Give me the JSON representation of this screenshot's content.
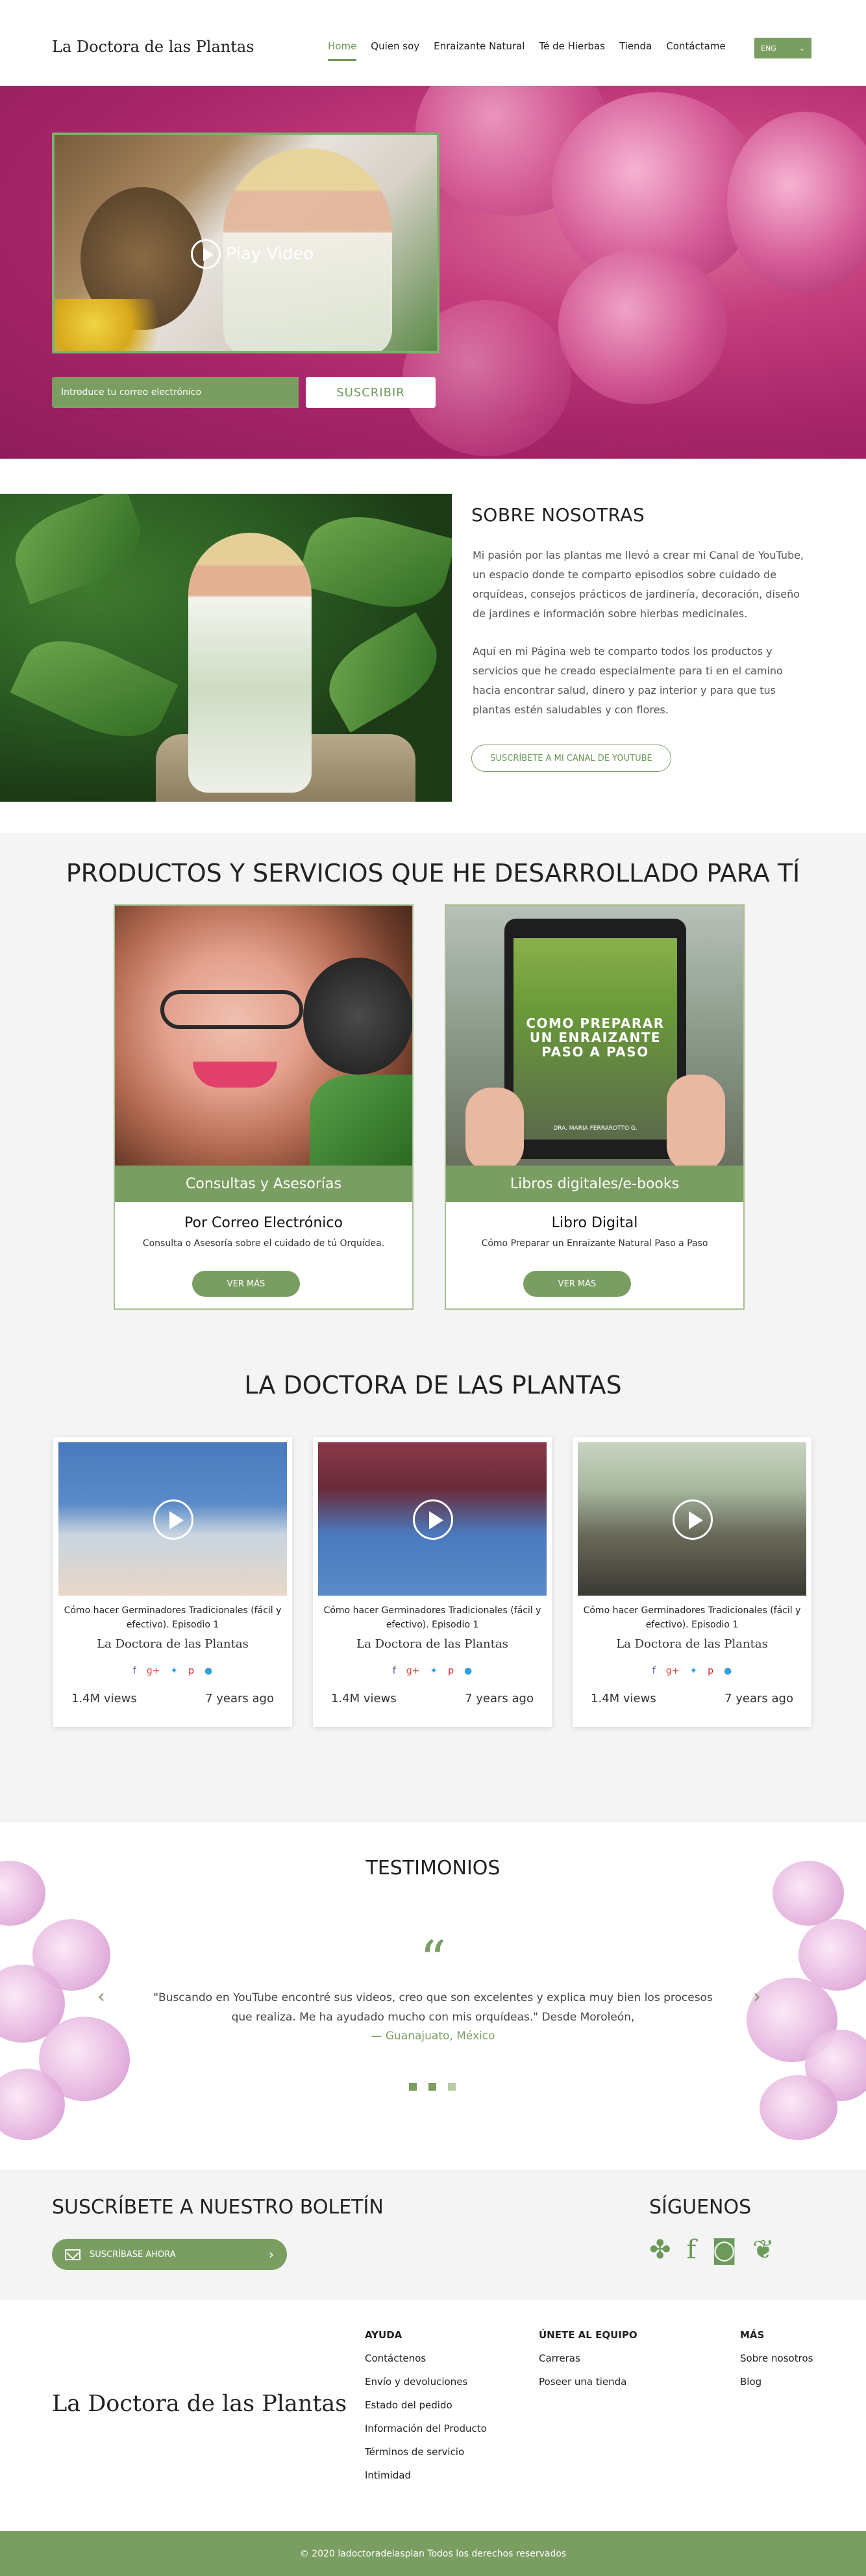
{
  "header": {
    "brand": "La Doctora de las Plantas",
    "nav": [
      "Home",
      "Quien soy",
      "Enraizante Natural",
      "Té de Hierbas",
      "Tienda",
      "Contáctame"
    ],
    "lang": "ENG"
  },
  "hero": {
    "video_label": "Play Video",
    "email_placeholder": "Introduce tu correo electrónico",
    "subscribe": "SUSCRIBIR"
  },
  "about": {
    "title": "SOBRE NOSOTRAS",
    "p1": "Mi pasión por las plantas me llevó a crear mi Canal de YouTube, un espacio donde te comparto episodios sobre cuidado de orquídeas,  consejos prácticos de jardinería, decoración, diseño de jardines e información sobre hierbas medicinales.",
    "p2": "Aquí en mi Página web te comparto todos los productos y servicios que he creado especialmente para ti en el camino hacia encontrar salud, dinero y paz interior y para que tus plantas estén saludables y con flores.",
    "button": "SUSCRÍBETE A MI CANAL DE YOUTUBE"
  },
  "products": {
    "title": "PRODUCTOS Y SERVICIOS QUE HE DESARROLLADO PARA TÍ",
    "items": [
      {
        "band": "Consultas y Asesorías",
        "title": "Por  Correo Electrónico",
        "desc": "Consulta o Asesoría sobre el cuidado de tú Orquídea.",
        "button": "VER MÁS"
      },
      {
        "band": "Libros digitales/e-books",
        "title": "Libro Digital",
        "desc": "Cómo Preparar un Enraizante Natural Paso a Paso",
        "button": "VER MÁS",
        "book_title": "COMO PREPARAR UN ENRAIZANTE PASO A PASO",
        "book_author": "DRA. MARIA FERRAROTTO G."
      }
    ]
  },
  "videos": {
    "title": "LA DOCTORA DE LAS PLANTAS",
    "items": [
      {
        "caption": "Cómo hacer Germinadores Tradicionales (fácil y efectivo). Episodio 1",
        "channel": "La Doctora de las Plantas",
        "views": "1.4M views",
        "age": "7 years ago"
      },
      {
        "caption": "Cómo hacer Germinadores Tradicionales (fácil y efectivo). Episodio 1",
        "channel": "La Doctora de las Plantas",
        "views": "1.4M views",
        "age": "7 years ago"
      },
      {
        "caption": "Cómo hacer Germinadores Tradicionales (fácil y efectivo). Episodio 1",
        "channel": "La Doctora de las Plantas",
        "views": "1.4M views",
        "age": "7 years ago"
      }
    ],
    "social_icons": [
      "facebook-icon",
      "google-plus-icon",
      "twitter-icon",
      "pinterest-icon",
      "tumblr-icon"
    ]
  },
  "testimonials": {
    "title": "TESTIMONIOS",
    "quote_mark": "“",
    "text": "\"Buscando en YouTube encontré sus videos, creo que son excelentes y explica muy bien los procesos que realiza. Me ha ayudado mucho con mis orquídeas.\" Desde Moroleón,",
    "author": "— Guanajuato, México",
    "prev": "‹",
    "next": "›"
  },
  "newsletter": {
    "title": "SUSCRÍBETE A NUESTRO BOLETÍN",
    "placeholder": "SUSCRÍBASE AHORA",
    "arrow": "›"
  },
  "follow": {
    "title": "SÍGUENOS",
    "icons": [
      "plant-icon",
      "facebook-icon",
      "instagram-icon",
      "sprout-icon"
    ]
  },
  "footer": {
    "brand": "La Doctora de las Plantas",
    "col1": {
      "head": "AYUDA",
      "links": [
        "Contáctenos",
        "Envío y devoluciones",
        "Estado del pedido",
        "Información del Producto",
        "Términos de servicio",
        "Intimidad"
      ]
    },
    "col2": {
      "head": "ÚNETE AL EQUIPO",
      "links": [
        "Carreras",
        "Poseer una tienda"
      ]
    },
    "col3": {
      "head": "MÁS",
      "links": [
        "Sobre nosotros",
        "Blog"
      ]
    },
    "copyright": "© 2020 ladoctoradelasplan Todos los derechos reservados"
  },
  "colors": {
    "accent": "#7a9e62",
    "hero": "#c53e7d"
  }
}
